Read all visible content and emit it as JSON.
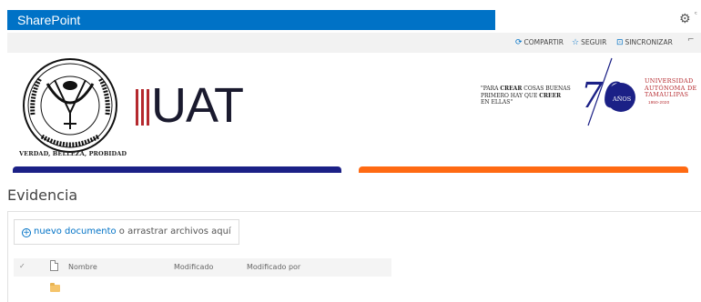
{
  "suite": {
    "brand": "SharePoint",
    "gear_icon": "gear-icon"
  },
  "actions": {
    "share": "COMPARTIR",
    "follow": "SEGUIR",
    "sync": "SINCRONIZAR"
  },
  "banner": {
    "seal_text_top": "UNIVERSIDAD AUTONOMA DE TAMAULIPAS",
    "motto": "VERDAD, BELLEZA, PROBIDAD",
    "uat_logo": "UAT",
    "quote_line1_pre": "\"PARA ",
    "quote_bold1": "CREAR",
    "quote_line1_post": " COSAS BUENAS",
    "quote_line2_pre": "PRIMERO HAY QUE ",
    "quote_bold2": "CREER",
    "quote_line3": "EN ELLAS\"",
    "anniversary_number": "70",
    "anniversary_word": "AÑOS",
    "univ_line1": "UNIVERSIDAD",
    "univ_line2": "AUTÓNOMA DE",
    "univ_line3": "TAMAULIPAS",
    "univ_years": "1950-2020",
    "colors": {
      "blue": "#1b2086",
      "orange": "#ff6a13",
      "red": "#b5292e",
      "sharepoint": "#0072c6"
    }
  },
  "page": {
    "title": "Evidencia"
  },
  "upload": {
    "link": "nuevo documento",
    "rest": " o arrastrar archivos aquí"
  },
  "list": {
    "columns": {
      "name": "Nombre",
      "modified": "Modificado",
      "modified_by": "Modificado por"
    },
    "rows": [
      {
        "type": "folder",
        "name": ""
      }
    ]
  }
}
